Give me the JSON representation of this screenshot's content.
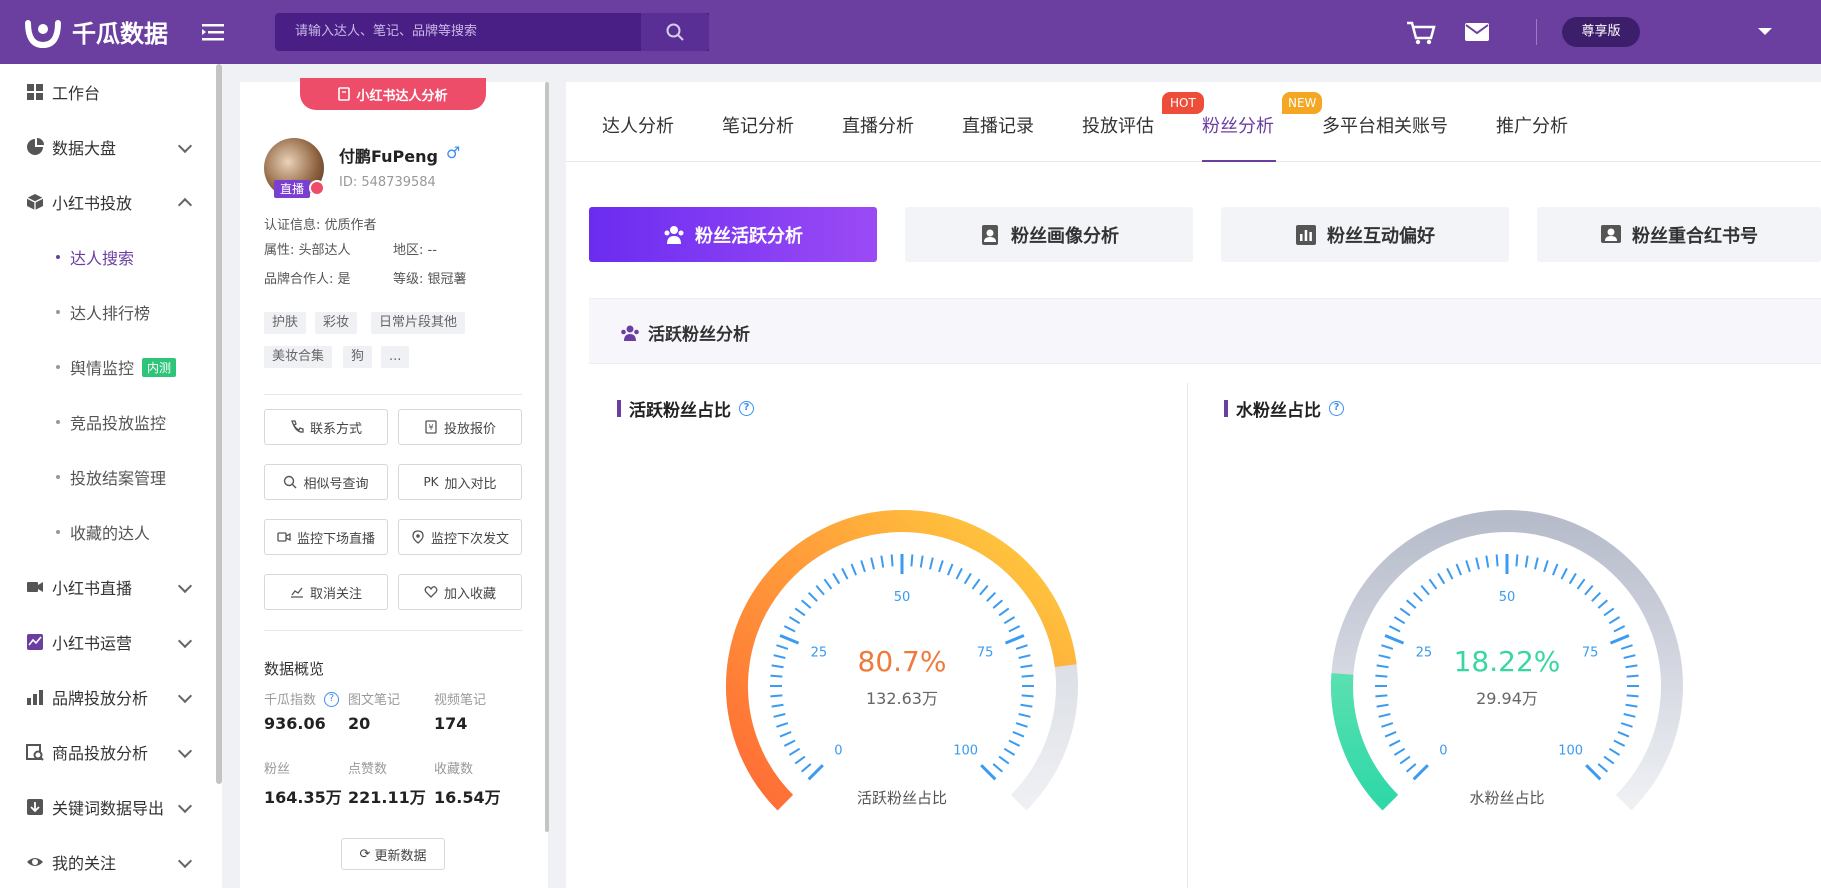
{
  "header": {
    "brand": "千瓜数据",
    "search_placeholder": "请输入达人、笔记、品牌等搜索",
    "vip_label": "尊享版"
  },
  "sidebar": {
    "items": [
      {
        "label": "工作台",
        "icon": "grid-icon"
      },
      {
        "label": "数据大盘",
        "icon": "pie-icon"
      },
      {
        "label": "小红书投放",
        "icon": "cube-icon"
      },
      {
        "label": "达人搜索"
      },
      {
        "label": "达人排行榜"
      },
      {
        "label": "舆情监控",
        "badge": "内测"
      },
      {
        "label": "竞品投放监控"
      },
      {
        "label": "投放结案管理"
      },
      {
        "label": "收藏的达人"
      },
      {
        "label": "小红书直播",
        "icon": "video-icon"
      },
      {
        "label": "小红书运营",
        "icon": "chart-icon"
      },
      {
        "label": "品牌投放分析",
        "icon": "bar-icon"
      },
      {
        "label": "商品投放分析",
        "icon": "product-icon"
      },
      {
        "label": "关键词数据导出",
        "icon": "download-icon"
      },
      {
        "label": "我的关注",
        "icon": "eye-icon"
      }
    ]
  },
  "profile": {
    "ribbon": "小红书达人分析",
    "live_badge": "直播",
    "name": "付鹏FuPeng",
    "gender_symbol": "♂",
    "id_text": "ID:  548739584",
    "auth": "认证信息:  优质作者",
    "attr": "属性:  头部达人",
    "region": "地区:  --",
    "brand_partner": "品牌合作人:  是",
    "level": "等级:  银冠薯",
    "tags": [
      "护肤",
      "彩妆",
      "日常片段其他",
      "美妆合集",
      "狗",
      "..."
    ],
    "buttons": [
      "联系方式",
      "投放报价",
      "相似号查询",
      "加入对比",
      "监控下场直播",
      "监控下次发文",
      "取消关注",
      "加入收藏"
    ],
    "pk_prefix": "PK",
    "data_title": "数据概览",
    "stats": [
      {
        "label": "千瓜指数",
        "value": "936.06"
      },
      {
        "label": "图文笔记",
        "value": "20"
      },
      {
        "label": "视频笔记",
        "value": "174"
      },
      {
        "label": "粉丝",
        "value": "164.35万"
      },
      {
        "label": "点赞数",
        "value": "221.11万"
      },
      {
        "label": "收藏数",
        "value": "16.54万"
      }
    ],
    "update_btn": "更新数据"
  },
  "tabs": [
    {
      "label": "达人分析"
    },
    {
      "label": "笔记分析"
    },
    {
      "label": "直播分析"
    },
    {
      "label": "直播记录"
    },
    {
      "label": "投放评估",
      "badge": "HOT"
    },
    {
      "label": "粉丝分析",
      "badge": "NEW",
      "active": true
    },
    {
      "label": "多平台相关账号"
    },
    {
      "label": "推广分析"
    }
  ],
  "subtabs": [
    {
      "label": "粉丝活跃分析",
      "active": true
    },
    {
      "label": "粉丝画像分析"
    },
    {
      "label": "粉丝互动偏好"
    },
    {
      "label": "粉丝重合红书号"
    }
  ],
  "section_title": "活跃粉丝分析",
  "gauges": [
    {
      "title": "活跃粉丝占比",
      "percent": "80.7%",
      "value_fraction": 0.807,
      "sub": "132.63万",
      "label": "活跃粉丝占比",
      "ticks": [
        "0",
        "25",
        "50",
        "75",
        "100"
      ],
      "color": "#f07a3a"
    },
    {
      "title": "水粉丝占比",
      "percent": "18.22%",
      "value_fraction": 0.1822,
      "sub": "29.94万",
      "label": "水粉丝占比",
      "ticks": [
        "0",
        "25",
        "50",
        "75",
        "100"
      ],
      "color": "#3ad6a0"
    }
  ],
  "colors": {
    "brand": "#6b3fa0",
    "accent_pink": "#ee4d6a",
    "tick_blue": "#3a9bf0"
  }
}
